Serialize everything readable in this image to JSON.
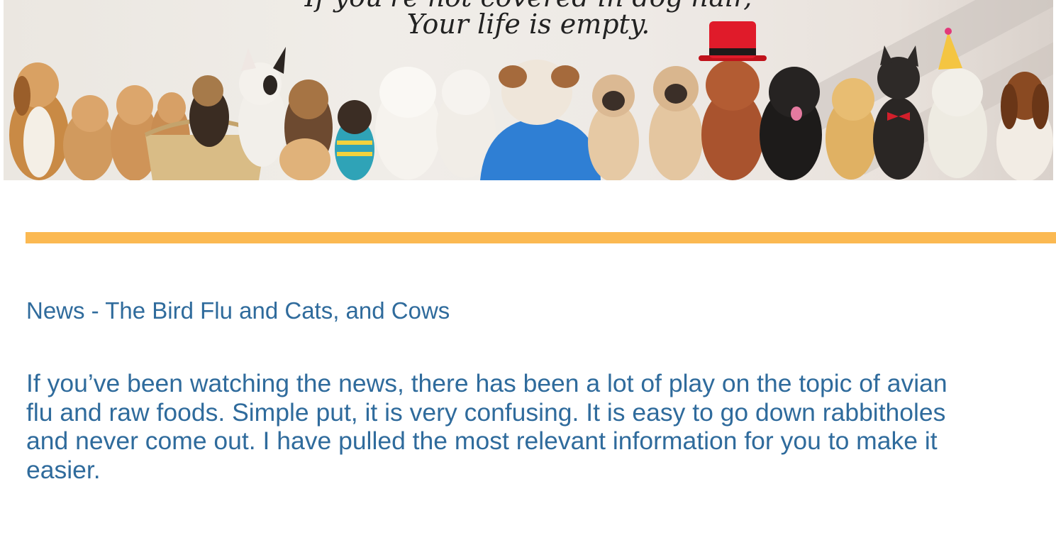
{
  "banner": {
    "quote_line_1": "If you're not covered in dog hair,",
    "quote_line_2": "Your life is empty."
  },
  "article": {
    "headline": "News - The Bird Flu and Cats, and Cows",
    "body_lines": [
      "If you’ve been watching the news, there has been a lot of play on the topic of avian",
      "flu and raw foods. Simple put, it is very confusing. It is easy to go down rabbitholes",
      "and never come out. I have pulled the most relevant information for you to make it",
      "easier."
    ]
  },
  "colors": {
    "divider": "#fbb952",
    "article_text": "#2f6b9c"
  }
}
